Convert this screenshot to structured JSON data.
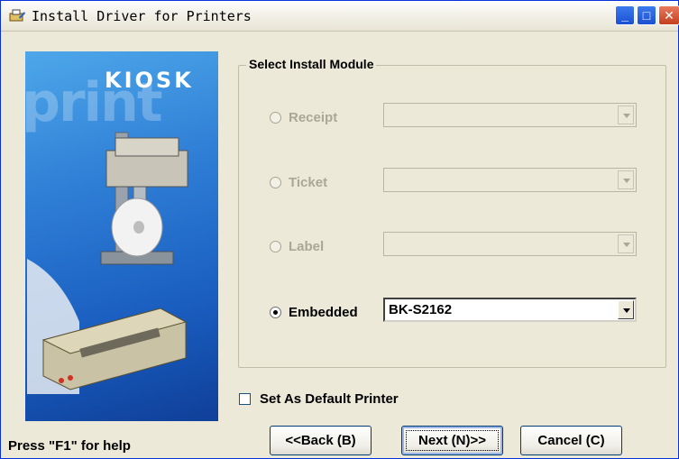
{
  "window": {
    "title": "Install Driver for Printers",
    "controls": {
      "minimize": "_",
      "maximize": "□",
      "close": "✕"
    }
  },
  "banner": {
    "brand": "KIOSK",
    "background_word": "print"
  },
  "group": {
    "legend": "Select Install Module",
    "options": [
      {
        "label": "Receipt",
        "selected": false,
        "enabled": false,
        "value": ""
      },
      {
        "label": "Ticket",
        "selected": false,
        "enabled": false,
        "value": ""
      },
      {
        "label": "Label",
        "selected": false,
        "enabled": false,
        "value": ""
      },
      {
        "label": "Embedded",
        "selected": true,
        "enabled": true,
        "value": "BK-S2162"
      }
    ]
  },
  "default_printer": {
    "label": "Set As Default Printer",
    "checked": false
  },
  "footer": {
    "help": "Press \"F1\" for help",
    "back_label": "<<Back (B)",
    "next_label": "Next (N)>>",
    "cancel_label": "Cancel (C)"
  },
  "colors": {
    "title_border": "#0831d9",
    "banner": "#2f7fd6",
    "face": "#ece9d8"
  },
  "icons": [
    "printer-setup-icon",
    "minimize-icon",
    "maximize-icon",
    "close-icon",
    "chevron-down-icon"
  ]
}
